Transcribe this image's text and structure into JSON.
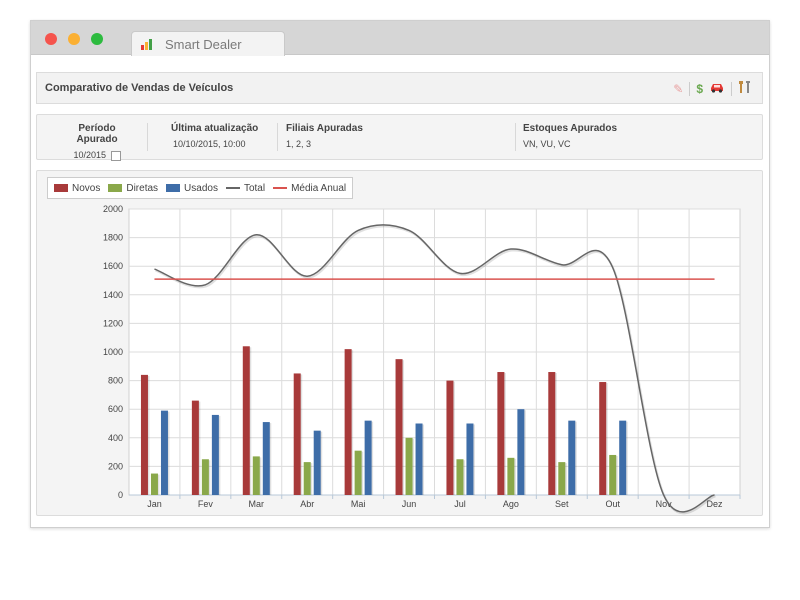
{
  "app": {
    "tab_title": "Smart Dealer"
  },
  "panel": {
    "title": "Comparativo de Vendas de Veículos",
    "icons": [
      "pin-icon",
      "dollar-icon",
      "car-icon",
      "tools-icon"
    ]
  },
  "info": {
    "periodo_label": "Período Apurado",
    "periodo_value": "10/2015",
    "atualizacao_label": "Última atualização",
    "atualizacao_value": "10/10/2015, 10:00",
    "filiais_label": "Filiais Apuradas",
    "filiais_value": "1, 2, 3",
    "estoques_label": "Estoques Apurados",
    "estoques_value": "VN, VU, VC"
  },
  "legend": {
    "novos": "Novos",
    "diretas": "Diretas",
    "usados": "Usados",
    "total": "Total",
    "media": "Média Anual"
  },
  "colors": {
    "novos": "#a83a3a",
    "diretas": "#8aa84a",
    "usados": "#3e6da8",
    "total": "#666666",
    "media": "#d9534f"
  },
  "chart_data": {
    "type": "bar",
    "categories": [
      "Jan",
      "Fev",
      "Mar",
      "Abr",
      "Mai",
      "Jun",
      "Jul",
      "Ago",
      "Set",
      "Out",
      "Nov",
      "Dez"
    ],
    "series": [
      {
        "name": "Novos",
        "values": [
          840,
          660,
          1040,
          850,
          1020,
          950,
          800,
          860,
          860,
          790,
          null,
          null
        ]
      },
      {
        "name": "Diretas",
        "values": [
          150,
          250,
          270,
          230,
          310,
          400,
          250,
          260,
          230,
          280,
          null,
          null
        ]
      },
      {
        "name": "Usados",
        "values": [
          590,
          560,
          510,
          450,
          520,
          500,
          500,
          600,
          520,
          520,
          null,
          null
        ]
      },
      {
        "name": "Total",
        "type": "line",
        "values": [
          1580,
          1470,
          1820,
          1530,
          1850,
          1850,
          1550,
          1720,
          1610,
          1590,
          0,
          0
        ]
      },
      {
        "name": "Média Anual",
        "type": "line",
        "values": [
          1510,
          1510,
          1510,
          1510,
          1510,
          1510,
          1510,
          1510,
          1510,
          1510,
          1510,
          1510
        ]
      }
    ],
    "yticks": [
      0,
      200,
      400,
      600,
      800,
      1000,
      1200,
      1400,
      1600,
      1800,
      2000
    ],
    "ylim": [
      0,
      2000
    ],
    "grid": true,
    "legend_position": "top-left"
  }
}
